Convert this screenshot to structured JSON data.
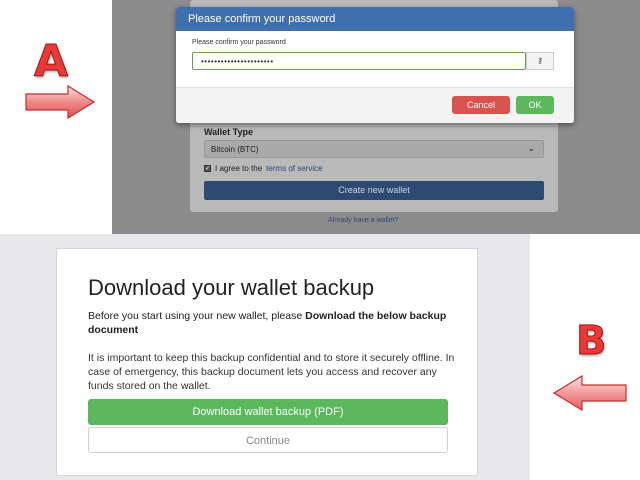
{
  "panel_a": {
    "marker_letter": "A",
    "modal": {
      "title": "Please confirm your password",
      "field_label": "Please confirm your password",
      "password_value": "••••••••••••••••••••••",
      "key_button": "⚷",
      "cancel_label": "Cancel",
      "ok_label": "OK"
    },
    "form": {
      "wallet_type_label": "Wallet Type",
      "wallet_type_value": "Bitcoin (BTC)",
      "agree_prefix": "I agree to the",
      "terms_link": "terms of service",
      "create_button": "Create new wallet",
      "already_link": "Already have a wallet?"
    }
  },
  "panel_b": {
    "marker_letter": "B",
    "title": "Download your wallet backup",
    "intro_prefix": "Before you start using your new wallet, please",
    "intro_bold": "Download the below backup document",
    "paragraph": "It is important to keep this backup confidential and to store it securely offline. In case of emergency, this backup document lets you access and recover any funds stored on the wallet.",
    "download_button": "Download wallet backup (PDF)",
    "continue_button": "Continue"
  },
  "colors": {
    "marker": "#e83a3a",
    "modal_header": "#3f6fad",
    "cancel": "#d9534f",
    "ok": "#5cb85c",
    "download": "#5cb85c"
  }
}
